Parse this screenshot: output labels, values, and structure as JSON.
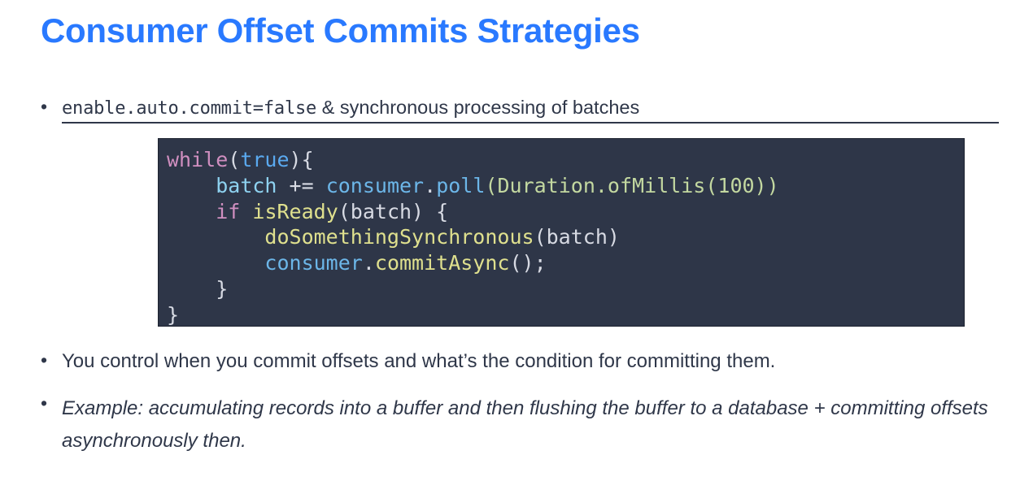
{
  "slide": {
    "title": "Consumer Offset Commits Strategies",
    "title_color": "#2979FF",
    "background_color": "#FFFFFF",
    "body_text_color": "#2F3749"
  },
  "bullets": [
    {
      "marker": "•",
      "code_part": "enable.auto.commit=false",
      "text_part": " & synchronous processing of batches",
      "underlined": true,
      "italic": false
    },
    {
      "marker": "•",
      "text": "You control when you commit offsets and what’s the condition for committing them.",
      "underlined": false,
      "italic": false
    },
    {
      "marker": "•",
      "text": "Example: accumulating records into a buffer and then flushing the buffer to a database + committing offsets asynchronously then.",
      "underlined": false,
      "italic": true
    }
  ],
  "code_block": {
    "background_color": "#2E3648",
    "border_color": "#1D2330",
    "language": "java",
    "raw": "while(true){\n    batch += consumer.poll(Duration.ofMillis(100))\n    if isReady(batch) {\n        doSomethingSynchronous(batch)\n        consumer.commitAsync();\n    }\n}",
    "lines": [
      {
        "n": 1,
        "text": "while(true){"
      },
      {
        "n": 2,
        "text": "    batch += consumer.poll(Duration.ofMillis(100))"
      },
      {
        "n": 3,
        "text": "    if isReady(batch) {"
      },
      {
        "n": 4,
        "text": "        doSomethingSynchronous(batch)"
      },
      {
        "n": 5,
        "text": "        consumer.commitAsync();"
      },
      {
        "n": 6,
        "text": "    }"
      },
      {
        "n": 7,
        "text": "}"
      }
    ],
    "tokens": {
      "l1": [
        {
          "t": "while",
          "c": "kw"
        },
        {
          "t": "(",
          "c": "plain"
        },
        {
          "t": "true",
          "c": "bool"
        },
        {
          "t": "){",
          "c": "plain"
        }
      ],
      "l2": [
        {
          "t": "    ",
          "c": "plain"
        },
        {
          "t": "batch",
          "c": "var"
        },
        {
          "t": " += ",
          "c": "plain"
        },
        {
          "t": "consumer",
          "c": "obj"
        },
        {
          "t": ".",
          "c": "plain"
        },
        {
          "t": "poll",
          "c": "obj"
        },
        {
          "t": "(",
          "c": "type"
        },
        {
          "t": "Duration.ofMillis(100)",
          "c": "type"
        },
        {
          "t": ")",
          "c": "type"
        }
      ],
      "l3": [
        {
          "t": "    ",
          "c": "plain"
        },
        {
          "t": "if",
          "c": "kw"
        },
        {
          "t": " ",
          "c": "plain"
        },
        {
          "t": "isReady",
          "c": "fn"
        },
        {
          "t": "(batch) {",
          "c": "plain"
        }
      ],
      "l4": [
        {
          "t": "        ",
          "c": "plain"
        },
        {
          "t": "doSomethingSynchronous",
          "c": "fn"
        },
        {
          "t": "(batch)",
          "c": "plain"
        }
      ],
      "l5": [
        {
          "t": "        ",
          "c": "plain"
        },
        {
          "t": "consumer",
          "c": "obj"
        },
        {
          "t": ".",
          "c": "plain"
        },
        {
          "t": "commitAsync",
          "c": "fn"
        },
        {
          "t": "();",
          "c": "plain"
        }
      ],
      "l6": [
        {
          "t": "    }",
          "c": "plain"
        }
      ],
      "l7": [
        {
          "t": "}",
          "c": "plain"
        }
      ]
    },
    "palette": {
      "keyword": "#D08FC0",
      "boolean": "#5AA9EF",
      "variable": "#8ED2F0",
      "object": "#6CB6E8",
      "function": "#DFE08E",
      "type": "#C3D8A0",
      "plain": "#D7DAE3"
    }
  }
}
